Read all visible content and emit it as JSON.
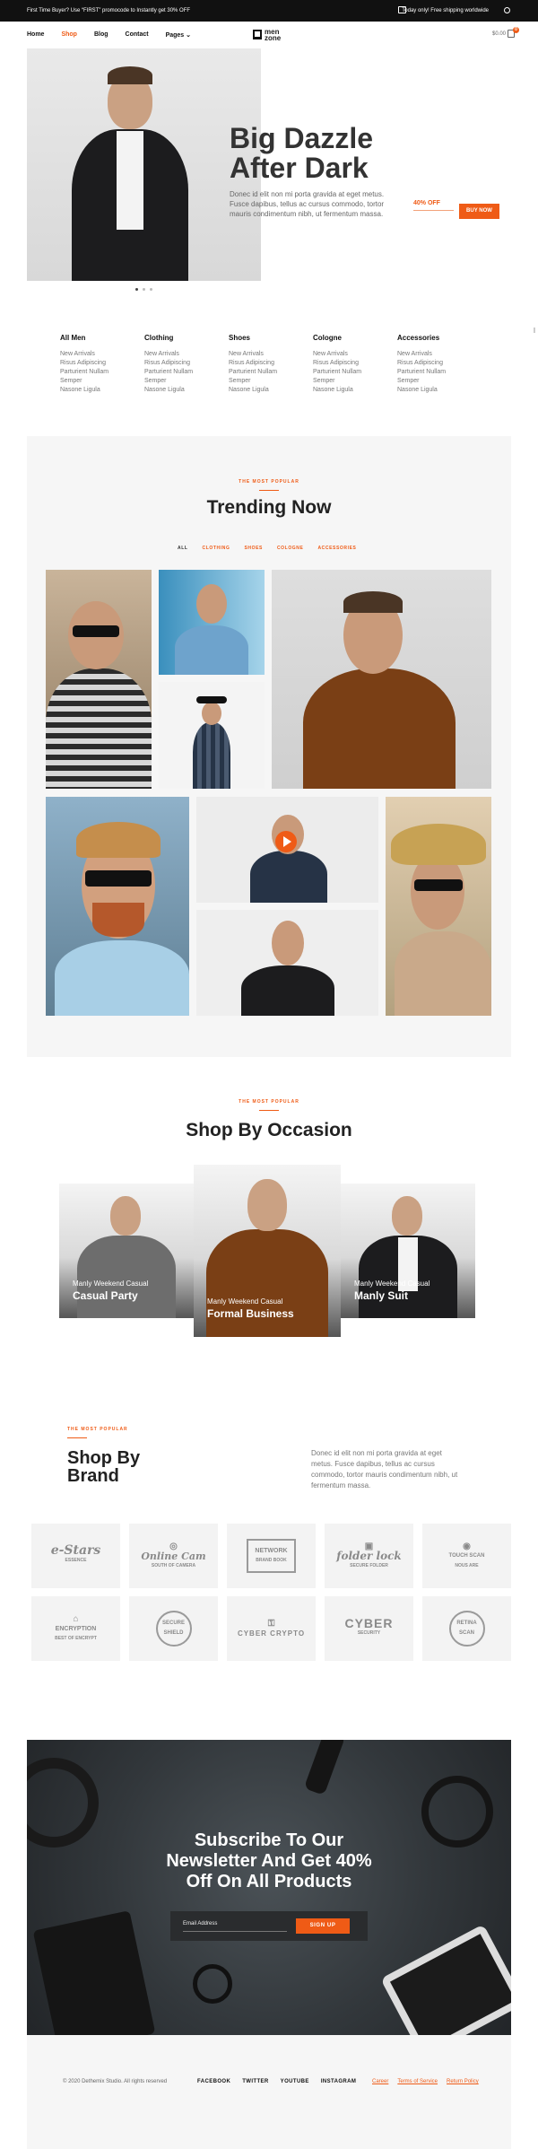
{
  "topbar": {
    "promo": "First Time Buyer? Use “FIRST” promocode to Instantly get 30% OFF",
    "shipping": "Today only! Free shipping worldwide"
  },
  "nav": {
    "items": [
      "Home",
      "Shop",
      "Blog",
      "Contact",
      "Pages"
    ],
    "logo_line1": "men",
    "logo_line2": "zone",
    "cart_total": "$0.00",
    "cart_count": "0"
  },
  "hero": {
    "title_line1": "Big Dazzle",
    "title_line2": "After Dark",
    "description": "Donec id elit non mi porta gravida at eget metus. Fusce dapibus, tellus ac cursus commodo, tortor mauris condimentum nibh, ut fermentum massa.",
    "offer": "40% OFF",
    "button": "BUY NOW"
  },
  "categories": [
    {
      "title": "All Men",
      "links": [
        "New Arrivals",
        "Risus Adipiscing",
        "Parturient Nullam",
        "Semper",
        "Nasone Ligula"
      ]
    },
    {
      "title": "Clothing",
      "links": [
        "New Arrivals",
        "Risus Adipiscing",
        "Parturient Nullam",
        "Semper",
        "Nasone Ligula"
      ]
    },
    {
      "title": "Shoes",
      "links": [
        "New Arrivals",
        "Risus Adipiscing",
        "Parturient Nullam",
        "Semper",
        "Nasone Ligula"
      ]
    },
    {
      "title": "Cologne",
      "links": [
        "New Arrivals",
        "Risus Adipiscing",
        "Parturient Nullam",
        "Semper",
        "Nasone Ligula"
      ]
    },
    {
      "title": "Accessories",
      "links": [
        "New Arrivals",
        "Risus Adipiscing",
        "Parturient Nullam",
        "Semper",
        "Nasone Ligula"
      ]
    }
  ],
  "trending": {
    "eyebrow": "THE MOST POPULAR",
    "title": "Trending Now",
    "filters": [
      "ALL",
      "CLOTHING",
      "SHOES",
      "COLOGNE",
      "ACCESSORIES"
    ]
  },
  "occasion": {
    "eyebrow": "THE MOST POPULAR",
    "title": "Shop By Occasion",
    "cards": [
      {
        "subtitle": "Manly Weekend Casual",
        "title": "Casual Party"
      },
      {
        "subtitle": "Manly Weekend Casual",
        "title": "Formal Business"
      },
      {
        "subtitle": "Manly Weekend Casual",
        "title": "Manly Suit"
      }
    ]
  },
  "brand": {
    "eyebrow": "THE MOST POPULAR",
    "title_line1": "Shop By",
    "title_line2": "Brand",
    "description": "Donec id elit non mi porta gravida at eget metus. Fusce dapibus, tellus ac cursus commodo, tortor mauris condimentum nibh, ut fermentum massa.",
    "logos": [
      {
        "main": "e-Stars",
        "sub": "ESSENCE"
      },
      {
        "main": "Online Cam",
        "sub": "SOUTH OF CAMERA"
      },
      {
        "main": "NETWORK",
        "sub": "BRAND BOOK"
      },
      {
        "main": "folder lock",
        "sub": "SECURE FOLDER"
      },
      {
        "main": "TOUCH SCAN",
        "sub": "NOUS ARE"
      },
      {
        "main": "ENCRYPTION",
        "sub": "BEST OF ENCRYPT"
      },
      {
        "main": "SECURE",
        "sub": "SHIELD"
      },
      {
        "main": "CYBER CRYPTO",
        "sub": ""
      },
      {
        "main": "CYBER",
        "sub": "SECURITY"
      },
      {
        "main": "RETINA SCAN",
        "sub": ""
      }
    ]
  },
  "newsletter": {
    "title_line1": "Subscribe To Our",
    "title_line2": "Newsletter And Get 40%",
    "title_line3": "Off On All Products",
    "email_placeholder": "Email Address",
    "button": "SIGN UP"
  },
  "footer": {
    "copyright": "© 2020 Dethemix Studio. All rights reserved",
    "social": [
      "FACEBOOK",
      "TWITTER",
      "YOUTUBE",
      "INSTAGRAM"
    ],
    "legal": [
      "Career",
      "Terms of Service",
      "Return Policy"
    ]
  },
  "colors": {
    "accent": "#ef5b16",
    "dark": "#111111",
    "panel": "#f6f6f6"
  }
}
